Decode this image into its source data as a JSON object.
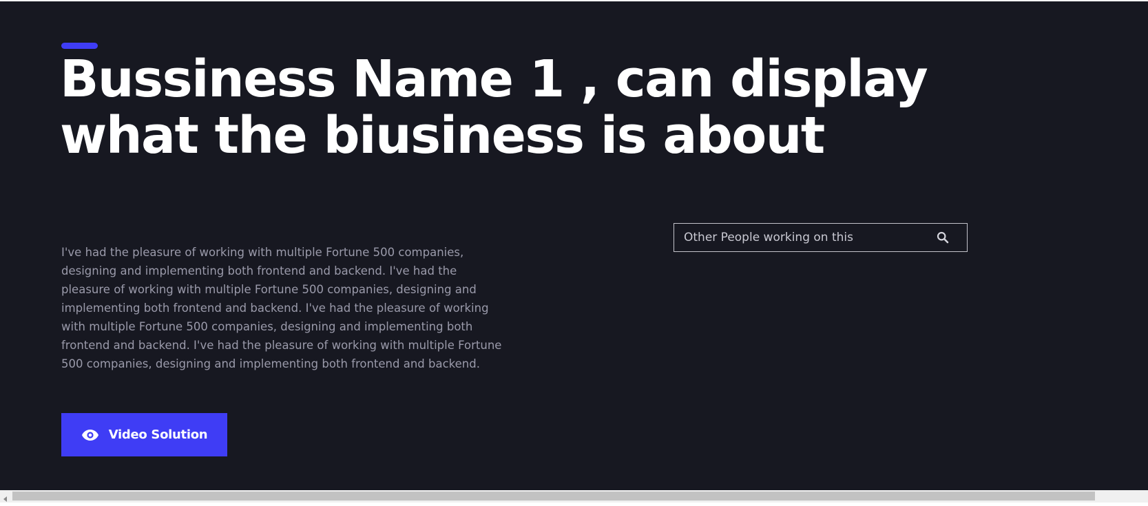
{
  "hero": {
    "headline": "Bussiness Name 1 , can display what the biusiness is about",
    "description": "I've had the pleasure of working with multiple Fortune 500 companies, designing and implementing both frontend and backend. I've had the pleasure of working with multiple Fortune 500 companies, designing and implementing both frontend and backend. I've had the pleasure of working with multiple Fortune 500 companies, designing and implementing both frontend and backend. I've had the pleasure of working with multiple Fortune 500 companies, designing and implementing both frontend and backend.",
    "button_label": "Video Solution",
    "button_icon": "eye-icon"
  },
  "search": {
    "placeholder": "Other People working on this",
    "value": "",
    "icon": "search-icon"
  },
  "colors": {
    "background": "#171821",
    "accent": "#3f3df5",
    "headline": "#ffffff",
    "body_text": "#9a9aaa",
    "search_border": "#c4c4cc"
  }
}
